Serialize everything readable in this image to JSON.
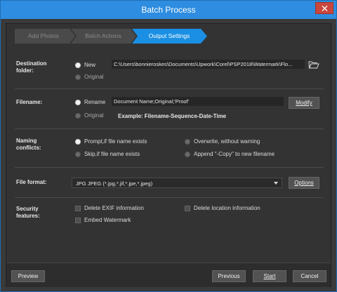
{
  "window": {
    "title": "Batch Process",
    "close_icon": "close-icon",
    "accent_color": "#1a8fe3",
    "titlebar_color": "#2e8de0"
  },
  "wizard": {
    "steps": [
      {
        "label": "Add Photos",
        "state": "done"
      },
      {
        "label": "Batch Actions",
        "state": "done"
      },
      {
        "label": "Output Settings",
        "state": "active"
      }
    ]
  },
  "destination": {
    "label_line1": "Destination",
    "label_line2": "folder:",
    "option_new": "New",
    "option_original": "Original",
    "selected": "New",
    "path": "C:\\Users\\bonnieroskes\\Documents\\Upwork\\Corel\\PSP2018\\Watermark\\Flo...",
    "browse_icon": "folder-open-icon"
  },
  "filename": {
    "label": "Filename:",
    "option_rename": "Rename",
    "option_original": "Original",
    "selected": "Rename",
    "pattern": "Document Name;Original;'Proof'",
    "modify_label": "Modify",
    "example": "Example: Filename-Sequence-Date-Time"
  },
  "naming": {
    "label_line1": "Naming",
    "label_line2": "conflicts:",
    "option_prompt": "Prompt,if file name exists",
    "option_skip": "Skip,if file name exists",
    "option_overwrite": "Overwrite, without warning",
    "option_append": "Append \"-Copy\" to new filename",
    "selected": "Prompt,if file name exists"
  },
  "format": {
    "label": "File format:",
    "selected_format": "JPG JPEG  (*.jpg,*.jif,*.jpe,*.jpeg)",
    "options_label": "Options"
  },
  "security": {
    "label_line1": "Security",
    "label_line2": "features:",
    "delete_exif": "Delete EXIF information",
    "delete_location": "Delete location information",
    "embed_watermark": "Embed Watermark"
  },
  "footer": {
    "preview": "Preview",
    "previous": "Previous",
    "start": "Start",
    "cancel": "Cancel"
  }
}
